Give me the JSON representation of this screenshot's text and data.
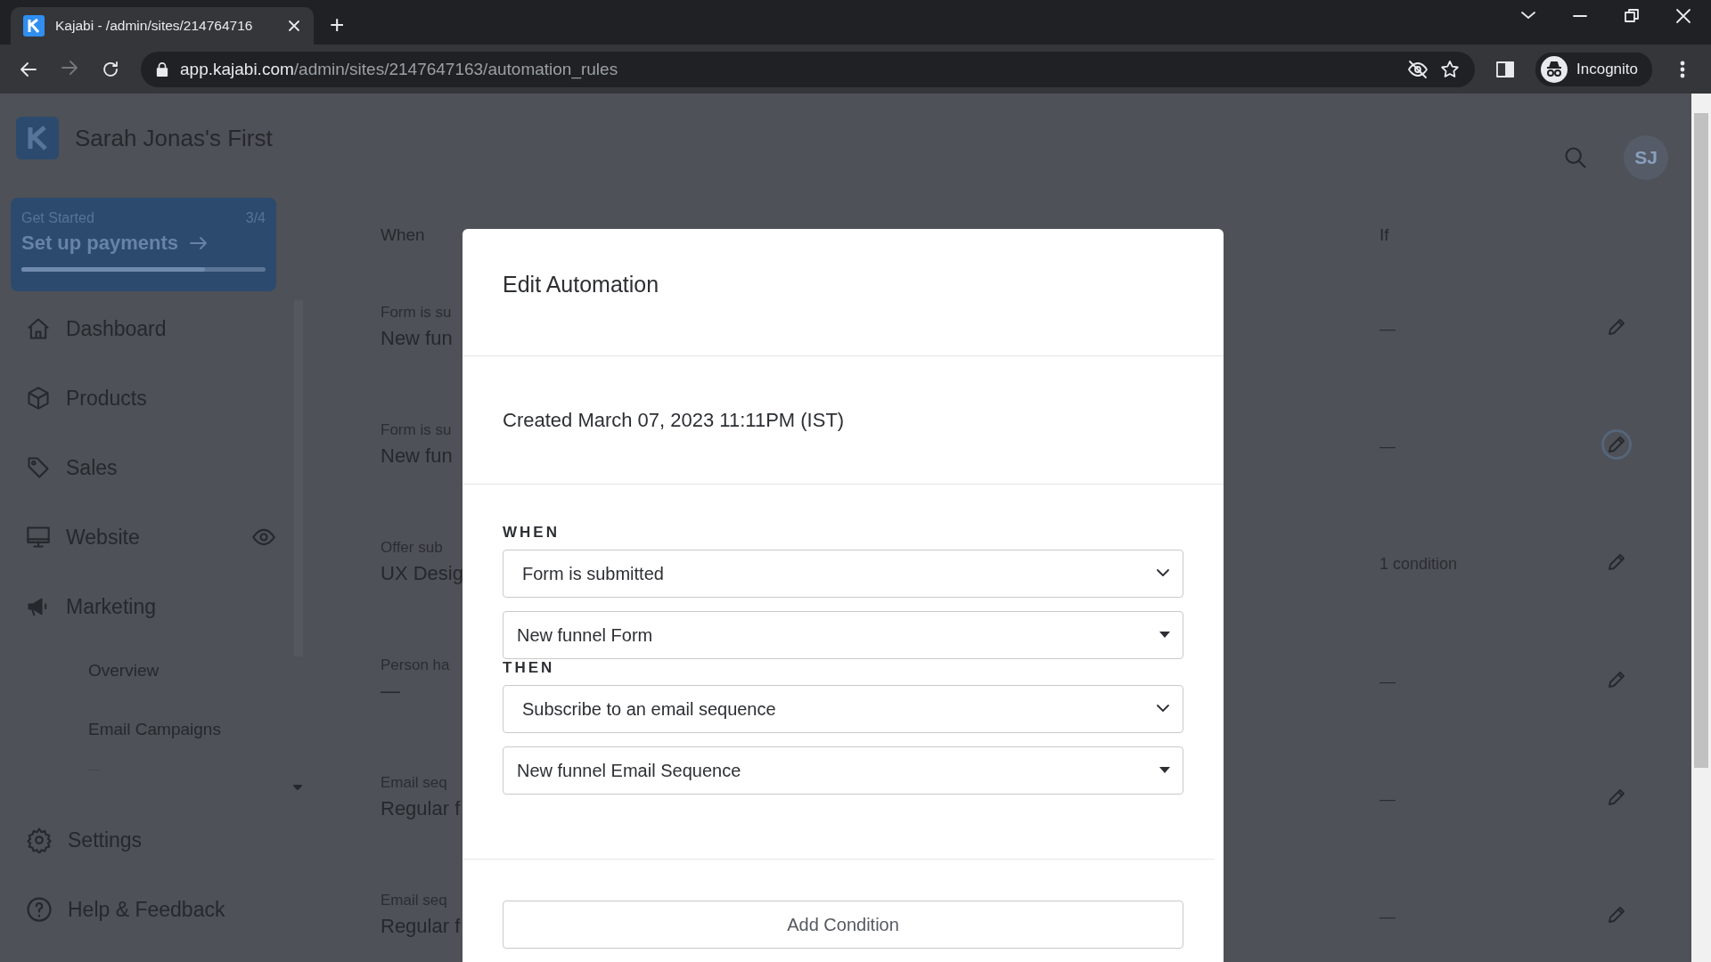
{
  "browser": {
    "tab_title": "Kajabi - /admin/sites/214764716",
    "new_tab": "+",
    "url_domain": "app.kajabi.com",
    "url_path": "/admin/sites/2147647163/automation_rules",
    "profile": "Incognito"
  },
  "sidebar": {
    "site_name": "Sarah Jonas's First",
    "get_started": {
      "label": "Get Started",
      "count": "3/4",
      "action": "Set up payments",
      "level": 0.75
    },
    "items": [
      {
        "label": "Dashboard",
        "preview": false
      },
      {
        "label": "Products",
        "preview": false
      },
      {
        "label": "Sales",
        "preview": false
      },
      {
        "label": "Website",
        "preview": true
      },
      {
        "label": "Marketing",
        "preview": false
      }
    ],
    "sub_items": [
      {
        "label": "Overview"
      },
      {
        "label": "Email Campaigns"
      }
    ],
    "footer_items": [
      {
        "label": "Settings"
      },
      {
        "label": "Help & Feedback"
      }
    ]
  },
  "header": {
    "avatar": "SJ"
  },
  "table": {
    "columns": [
      "When",
      "If"
    ],
    "rows": [
      {
        "event": "Form is su",
        "target": "New fun",
        "condition": "—",
        "focused": false
      },
      {
        "event": "Form is su",
        "target": "New fun",
        "condition": "—",
        "focused": true
      },
      {
        "event": "Offer sub",
        "target": "UX Desig",
        "condition": "1 condition",
        "focused": false
      },
      {
        "event": "Person ha",
        "target": "—",
        "condition": "—",
        "focused": false
      },
      {
        "event": "Email seq",
        "target": "Regular f",
        "condition": "—",
        "focused": false
      },
      {
        "event": "Email seq",
        "target": "Regular f",
        "condition": "—",
        "focused": false
      }
    ]
  },
  "modal": {
    "title": "Edit Automation",
    "created": "Created March 07, 2023 11:11PM (IST)",
    "sections": [
      {
        "label": "WHEN",
        "selects": [
          {
            "value": "Form is submitted",
            "kind": "native"
          },
          {
            "value": "New funnel Form",
            "kind": "custom"
          }
        ]
      },
      {
        "label": "THEN",
        "selects": [
          {
            "value": "Subscribe to an email sequence",
            "kind": "native"
          },
          {
            "value": "New funnel Email Sequence",
            "kind": "custom"
          }
        ]
      }
    ],
    "add_button": "Add Condition"
  }
}
